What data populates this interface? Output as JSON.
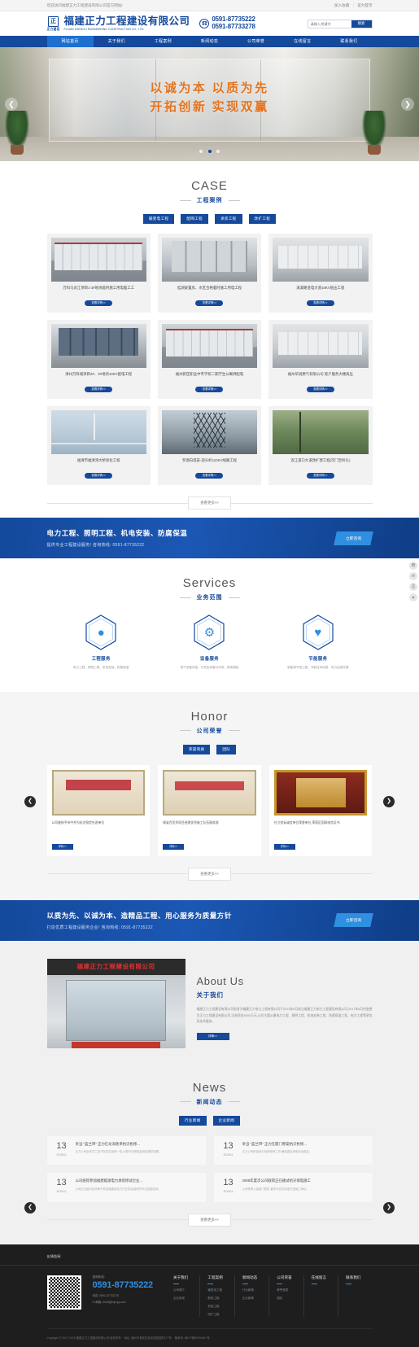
{
  "topbar": {
    "left": "欢迎访问福建正力工程建设有限公司官方网站!",
    "links": [
      "加入收藏",
      "设为首页"
    ]
  },
  "header": {
    "logo_mark": "正",
    "logo_sub": "正力建设",
    "company_cn": "福建正力工程建设有限公司",
    "company_en": "FUJIAN ZHENGLI ENGINEERING CONSTRUCTION CO., LTD.",
    "phone_icon": "phone-icon",
    "phone1": "0591-87735222",
    "phone2": "0591-87733278",
    "search_placeholder": "请输入关键字",
    "search_button": "搜索"
  },
  "nav": {
    "items": [
      {
        "label": "网站首页",
        "active": true
      },
      {
        "label": "关于我们",
        "active": false
      },
      {
        "label": "工程案例",
        "active": false
      },
      {
        "label": "新闻动态",
        "active": false
      },
      {
        "label": "公司荣誉",
        "active": false
      },
      {
        "label": "在线留言",
        "active": false
      },
      {
        "label": "联系我们",
        "active": false
      }
    ]
  },
  "banner": {
    "line1": "以诚为本 以质为先",
    "line2": "开拓创新 实现双赢",
    "prev_icon": "chevron-left-icon",
    "next_icon": "chevron-right-icon",
    "dots": 3,
    "active_dot": 1
  },
  "case": {
    "title_en": "CASE",
    "title_cn": "工程案例",
    "tabs": [
      "输变电工程",
      "配网工程",
      "承装工程",
      "改扩工程"
    ],
    "cards": [
      {
        "caption": "万科乌龙江项目1-3#地块临时施工用电临工工",
        "button": "查看详情>>",
        "img": "switchgear"
      },
      {
        "caption": "桂湖安置房、水区合格临时施工用电工程",
        "button": "查看详情>>",
        "img": "corridor"
      },
      {
        "caption": "溪源路变电大道10KV低压工程",
        "button": "查看详情>>",
        "img": "cabinet"
      },
      {
        "caption": "漳州万科城项目2#、3#地块10KV配电工程",
        "button": "查看详情>>",
        "img": "panel"
      },
      {
        "caption": "福州新区职业中专学校二期学生公寓供配电",
        "button": "查看详情>>",
        "img": "switchgear"
      },
      {
        "caption": "福州华润燃气有限公司 客户服务大楼高压",
        "button": "查看详情>>",
        "img": "cabinet"
      },
      {
        "caption": "福清市福清湾大桥亮化工程",
        "button": "查看详情>>",
        "img": "bridge"
      },
      {
        "caption": "罗源白塔安-迎头岭110KV线路工程",
        "button": "查看详情>>",
        "img": "tower"
      },
      {
        "caption": "连江浦口大道改扩建工程(可门至岭头)",
        "button": "查看详情>>",
        "img": "hill"
      }
    ],
    "more": "查看更多>>"
  },
  "cta1": {
    "line1": "电力工程、照明工程、机电安装、防腐保温",
    "line2": "提供专业工程建设服务!  咨询热线: 0591-87735222",
    "button": "立即咨询"
  },
  "services": {
    "title_en": "Services",
    "title_cn": "业务范围",
    "items": [
      {
        "icon": "lightbulb-icon",
        "glyph": "●",
        "name": "工程服务",
        "desc": "电力工程、照明工程、机电安装、防腐保温"
      },
      {
        "icon": "gear-icon",
        "glyph": "⚙",
        "name": "设备服务",
        "desc": "电气设备安装、开关柜成套与供电、配电箱柜"
      },
      {
        "icon": "heart-icon",
        "glyph": "♥",
        "name": "节能服务",
        "desc": "新能源节电工程、节能技术改造、电力运维托管"
      }
    ]
  },
  "honor": {
    "title_en": "Honor",
    "title_cn": "公司荣誉",
    "tabs": [
      "荣誉资质",
      "团队"
    ],
    "cards": [
      {
        "caption": "公司被授予市中共为抗灾抢险先进单位",
        "button": "详情>>",
        "img": "cert"
      },
      {
        "caption": "闽省百优秀项目经理优秀施工队伍服务部",
        "button": "详情>>",
        "img": "cert2"
      },
      {
        "caption": "社力投标诚信单位荣誉单位,荣获区国网电信证书",
        "button": "详情>>",
        "img": "plaque"
      }
    ],
    "more": "查看更多>>",
    "prev_icon": "chevron-left-icon",
    "next_icon": "chevron-right-icon"
  },
  "cta2": {
    "line1": "以质为先、以诚为本、造精品工程、用心服务为质量方针",
    "line2": "打造优质工程建设服务企业!     咨询热线: 0591-87735222",
    "button": "立即咨询"
  },
  "about": {
    "sign": "福建正力工程建设有限公司",
    "title_en": "About Us",
    "title_cn": "关于我们",
    "paragraph": "福建正力工程建设有限公司前身为福建正力电力工程有限公司于2013年5月成立福建正力电力工程建设有限公司,2017年8月份变更为正力工程建设有限公司,注册资金5000万元,公司主要从事电力工程、照明工程、机电安装工程、防腐保温工程、电力工程等承包及技术服务。",
    "button": "详情>>"
  },
  "news": {
    "title_en": "News",
    "title_cn": "新闻动态",
    "tabs": [
      "行业新闻",
      "企业新闻"
    ],
    "items": [
      {
        "day": "13",
        "date": "2019/11",
        "title": "争当 \"蓝兰带\" 正力在龙海免单抗灾抢修...",
        "desc": "正力公司全体员工坚守在抗灾抢修一线,为群众尽快恢复用电提供保障。"
      },
      {
        "day": "13",
        "date": "2019/11",
        "title": "争当 \"蓝兰带\" 正力在厦门移安抗灾抢修...",
        "desc": "正力公司积极参与电网抢修工作,确保居民用电安全稳定。"
      },
      {
        "day": "13",
        "date": "2019/11",
        "title": "公司组得参加福建能源电力承装修试企业...",
        "desc": "公司近日组织技术骨干参加福建省电力行业协会组织的专业技能培训。"
      },
      {
        "day": "13",
        "date": "2019/11",
        "title": "2008年度次公司取得正在顺试抗灾保电施工",
        "desc": "公司获得上级部门表彰,被评为抗灾保电先进施工单位。"
      }
    ],
    "more": "查看更多>>",
    "prev_icon": "chevron-left-icon",
    "next_icon": "chevron-right-icon"
  },
  "footer": {
    "friendlink": "友情链接:",
    "qr_alt": "qr-code-icon",
    "contact_label": "咨询热线:",
    "phone": "0591-87735222",
    "fax": "传真: 0591-87733278",
    "mail_icon": "mail-icon",
    "email": "邮箱: zmzlfj@vip.qq.com",
    "columns": [
      {
        "title": "关于我们",
        "links": [
          "公司简介",
          "企业风采"
        ]
      },
      {
        "title": "工程案例",
        "links": [
          "输变电工程",
          "配电工程",
          "机电工程",
          "改扩工程"
        ]
      },
      {
        "title": "新闻动态",
        "links": [
          "行业新闻",
          "企业新闻"
        ]
      },
      {
        "title": "公司荣誉",
        "links": [
          "荣誉资质",
          "团队"
        ]
      },
      {
        "title": "在线留言",
        "links": []
      },
      {
        "title": "联系我们",
        "links": []
      }
    ],
    "copyright": "Copyright © 2007-2025 福建正力工程建设有限公司 版权所有",
    "copy_extra": "地址: 福州市晋安区新店镇西园村177号",
    "icp_label": "备案号:",
    "icp": "闽ICP备05004647号"
  },
  "side_toolbar": {
    "icons": [
      "phone-icon",
      "message-icon",
      "qr-icon",
      "arrow-up-icon"
    ],
    "glyphs": [
      "☎",
      "✉",
      "▦",
      "▲"
    ]
  },
  "colors": {
    "brand_blue": "#14499b",
    "accent_blue": "#2f8fe0",
    "banner_orange": "#e2731d",
    "footer_bg": "#1e1e1e"
  }
}
